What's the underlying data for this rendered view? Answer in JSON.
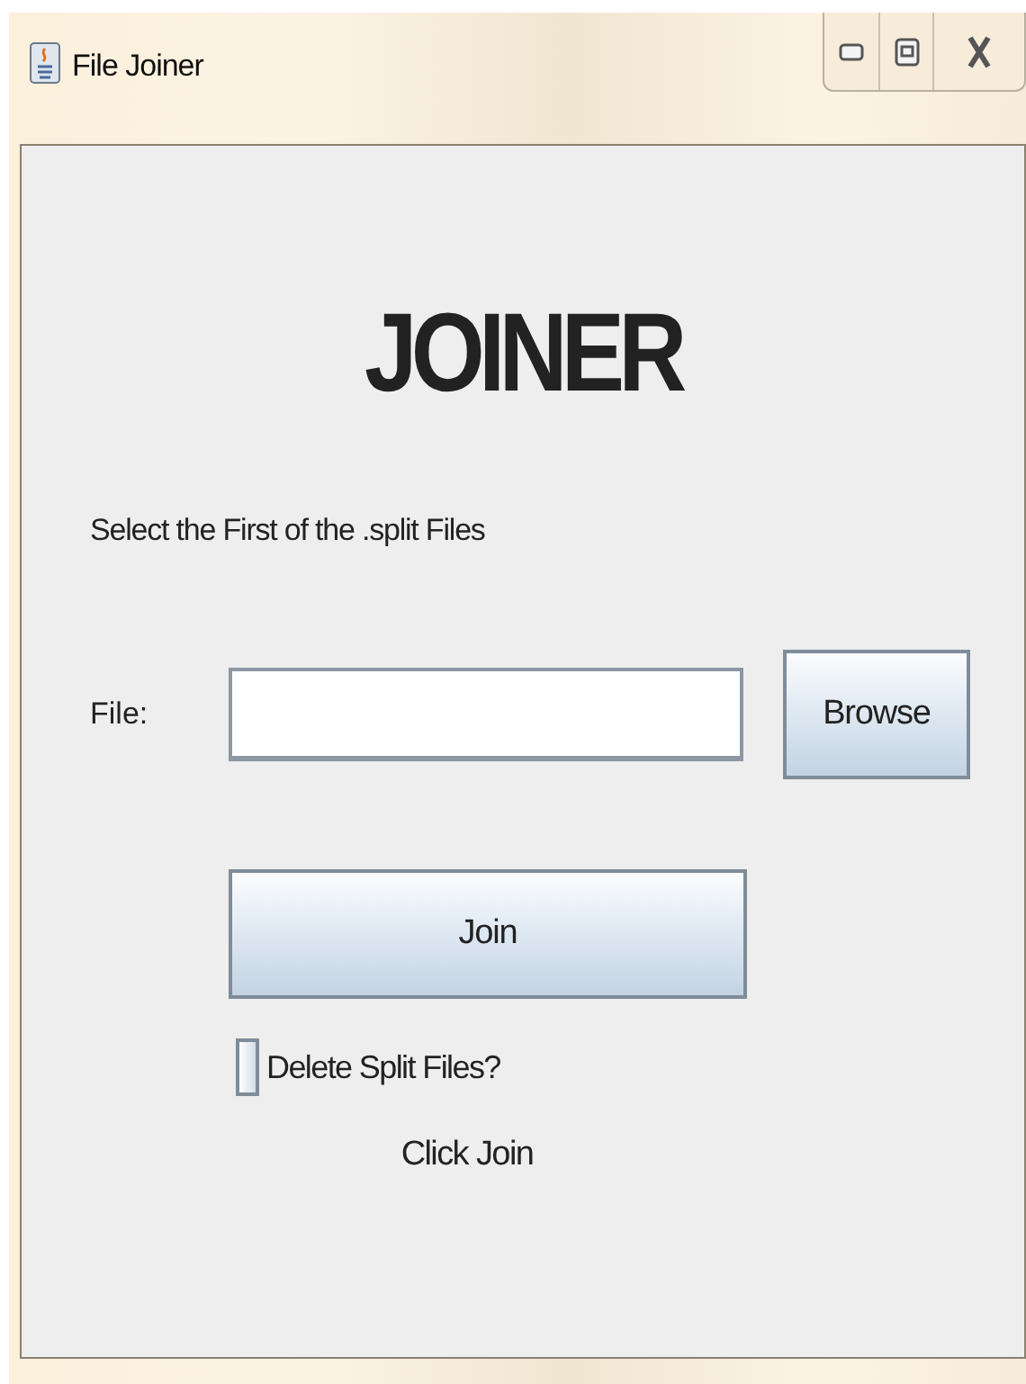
{
  "window": {
    "title": "File Joiner"
  },
  "heading": "JOINER",
  "instruction": "Select the First of the .split Files",
  "file_field": {
    "label": "File:"
  },
  "buttons": {
    "browse": "Browse",
    "join": "Join"
  },
  "delete_option": {
    "label": "Delete Split Files?",
    "checked": false
  },
  "status": "Click Join"
}
